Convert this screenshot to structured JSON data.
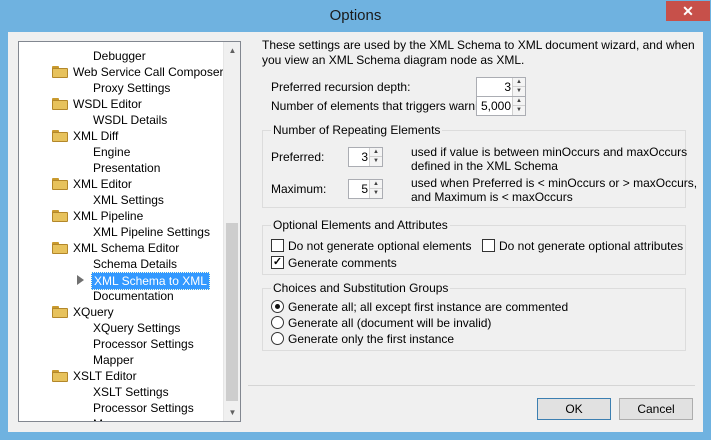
{
  "window": {
    "title": "Options",
    "close_glyph": "✕"
  },
  "tree": {
    "items": [
      {
        "label": "Debugger",
        "type": "child"
      },
      {
        "label": "Web Service Call Composer",
        "type": "folder"
      },
      {
        "label": "Proxy Settings",
        "type": "child"
      },
      {
        "label": "WSDL Editor",
        "type": "folder"
      },
      {
        "label": "WSDL Details",
        "type": "child"
      },
      {
        "label": "XML Diff",
        "type": "folder"
      },
      {
        "label": "Engine",
        "type": "child"
      },
      {
        "label": "Presentation",
        "type": "child"
      },
      {
        "label": "XML Editor",
        "type": "folder"
      },
      {
        "label": "XML Settings",
        "type": "child"
      },
      {
        "label": "XML Pipeline",
        "type": "folder"
      },
      {
        "label": "XML Pipeline Settings",
        "type": "child"
      },
      {
        "label": "XML Schema Editor",
        "type": "folder"
      },
      {
        "label": "Schema Details",
        "type": "child"
      },
      {
        "label": "XML Schema to XML",
        "type": "child",
        "selected": true
      },
      {
        "label": "Documentation",
        "type": "child"
      },
      {
        "label": "XQuery",
        "type": "folder"
      },
      {
        "label": "XQuery Settings",
        "type": "child"
      },
      {
        "label": "Processor Settings",
        "type": "child"
      },
      {
        "label": "Mapper",
        "type": "child"
      },
      {
        "label": "XSLT Editor",
        "type": "folder"
      },
      {
        "label": "XSLT Settings",
        "type": "child"
      },
      {
        "label": "Processor Settings",
        "type": "child"
      },
      {
        "label": "M...",
        "type": "child"
      }
    ]
  },
  "intro": "These settings are used by the XML Schema to XML document wizard, and when you view an XML Schema diagram node as XML.",
  "recursion": {
    "label": "Preferred recursion depth:",
    "value": "3"
  },
  "warning": {
    "label": "Number of elements that triggers warning:",
    "value": "5,000"
  },
  "repeating": {
    "title": "Number of Repeating Elements",
    "preferred_label": "Preferred:",
    "preferred_value": "3",
    "preferred_desc_1": "used if value is between minOccurs and maxOccurs",
    "preferred_desc_2": "defined in the XML Schema",
    "maximum_label": "Maximum:",
    "maximum_value": "5",
    "maximum_desc_1": "used when Preferred is < minOccurs or > maxOccurs,",
    "maximum_desc_2": "and Maximum is < maxOccurs"
  },
  "optional": {
    "title": "Optional Elements and Attributes",
    "no_opt_elements": "Do not generate optional elements",
    "no_opt_elements_checked": false,
    "no_opt_attrs": "Do not generate optional attributes",
    "no_opt_attrs_checked": false,
    "gen_comments": "Generate comments",
    "gen_comments_checked": true
  },
  "choices": {
    "title": "Choices and Substitution Groups",
    "options": [
      {
        "label": "Generate all; all except first instance are commented",
        "selected": true
      },
      {
        "label": "Generate all (document will be invalid)",
        "selected": false
      },
      {
        "label": "Generate only the first instance",
        "selected": false
      }
    ]
  },
  "buttons": {
    "ok": "OK",
    "cancel": "Cancel"
  },
  "icons": {
    "spin_up": "▲",
    "spin_down": "▼",
    "check": "✓"
  },
  "colors": {
    "title_bar": "#6fb2e0",
    "selection": "#3399ff",
    "close": "#c7504a"
  }
}
